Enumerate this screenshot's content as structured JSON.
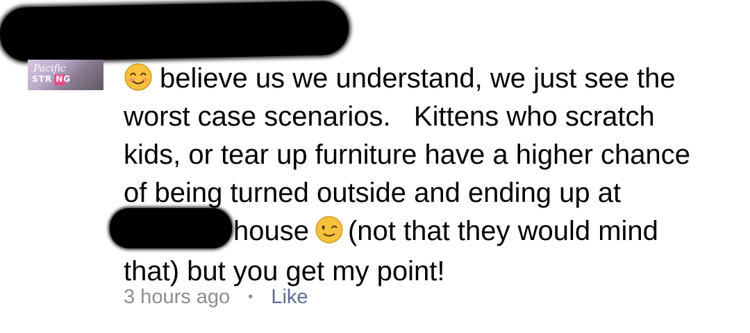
{
  "comment": {
    "lines": [
      "believe us we understand, we just see the",
      "worst case scenarios.   Kittens who scratch",
      "kids, or tear up furniture have a higher chance",
      "of being turned outside and ending up at"
    ],
    "line5_after_redaction": "house",
    "line5_after_emoji": "(not that they would mind",
    "line6": "that) but you get my point!",
    "emojis": [
      "smiling-face-emoji",
      "winking-face-emoji"
    ]
  },
  "avatar": {
    "logo_top": "Pacific",
    "logo_bottom": "STR  NG"
  },
  "meta": {
    "time": "3 hours ago",
    "separator": "•",
    "like_label": "Like"
  },
  "colors": {
    "text": "#000000",
    "meta_text": "#8d8d8d",
    "like_link": "#5f6b95",
    "redaction": "#000000"
  }
}
